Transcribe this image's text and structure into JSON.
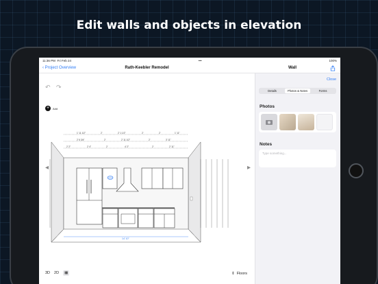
{
  "headline": "Edit walls and objects in elevation",
  "status_bar": {
    "time": "11:36 PM",
    "date": "Fri Feb 24",
    "dots": "•••",
    "battery": "100%"
  },
  "nav": {
    "back_label": "Project Overview",
    "title": "Rath-Keebler Remodel"
  },
  "panel": {
    "title": "Wall",
    "close_label": "Close",
    "tabs": [
      {
        "label": "Details",
        "active": false
      },
      {
        "label": "Photos & Notes",
        "active": true
      },
      {
        "label": "Forms",
        "active": false
      }
    ],
    "photos_heading": "Photos",
    "notes_heading": "Notes",
    "notes_placeholder": "Type something..."
  },
  "canvas": {
    "add_label": "Add",
    "view_modes": [
      "3D",
      "2D"
    ],
    "floors_label": "Floors",
    "dimensions": {
      "top_rows": [
        [
          "1' 11 1/2\"",
          "2'",
          "2' 1 1/2\"",
          "2'",
          "2'",
          "1' 11\""
        ],
        [
          "2' 6 3/4\"",
          "2'",
          "2' 11 1/2\"",
          "2'",
          "3' 11\""
        ],
        [
          "2' 2\"",
          "2' 4\"",
          "2'",
          "4' 2\"",
          "2'",
          "2' 11\""
        ]
      ],
      "total_width": "14' 10\""
    }
  },
  "colors": {
    "accent": "#2f7cf6",
    "screen_bg": "#ffffff",
    "panel_bg": "#f2f2f6",
    "page_bg": "#0c1724"
  }
}
